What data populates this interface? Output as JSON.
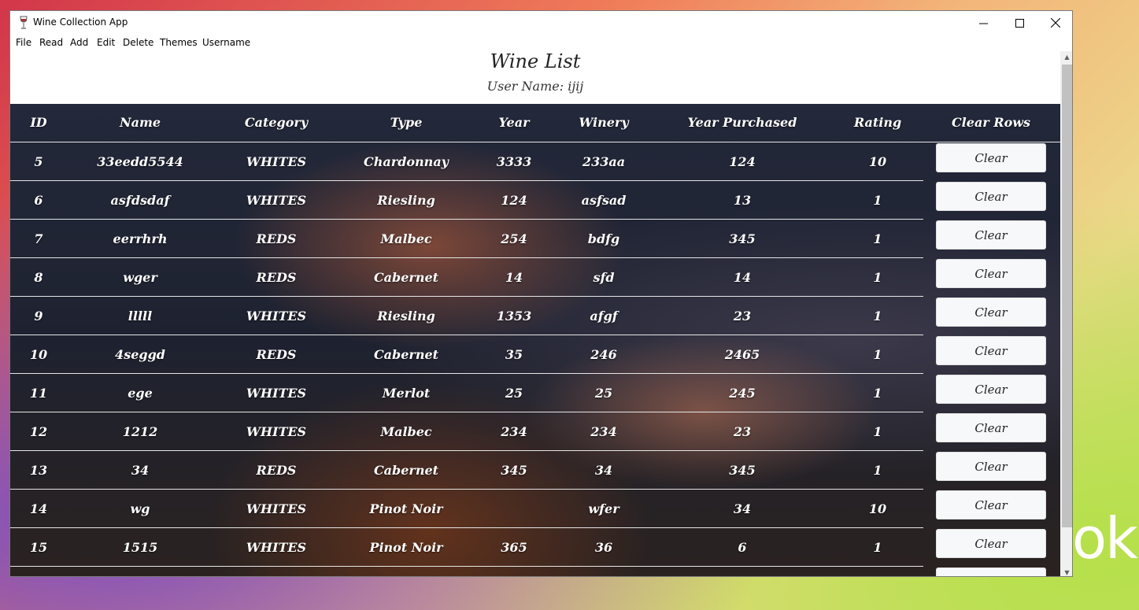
{
  "window": {
    "title": "Wine Collection App",
    "controls": {
      "minimize": "—",
      "maximize": "☐",
      "close": "✕"
    }
  },
  "menu": [
    "File",
    "Read",
    "Add",
    "Edit",
    "Delete",
    "Themes",
    "Username"
  ],
  "page": {
    "title": "Wine List",
    "user_line": "User Name: ijij"
  },
  "table": {
    "columns": [
      "ID",
      "Name",
      "Category",
      "Type",
      "Year",
      "Winery",
      "Year Purchased",
      "Rating",
      "Clear Rows"
    ],
    "button_label": "Clear",
    "rows": [
      [
        "5",
        "33eedd5544",
        "WHITES",
        "Chardonnay",
        "3333",
        "233aa",
        "124",
        "10"
      ],
      [
        "6",
        "asfdsdaf",
        "WHITES",
        "Riesling",
        "124",
        "asfsad",
        "13",
        "1"
      ],
      [
        "7",
        "eerrhrh",
        "REDS",
        "Malbec",
        "254",
        "bdfg",
        "345",
        "1"
      ],
      [
        "8",
        "wger",
        "REDS",
        "Cabernet",
        "14",
        "sfd",
        "14",
        "1"
      ],
      [
        "9",
        "lllll",
        "WHITES",
        "Riesling",
        "1353",
        "afgf",
        "23",
        "1"
      ],
      [
        "10",
        "4seggd",
        "REDS",
        "Cabernet",
        "35",
        "246",
        "2465",
        "1"
      ],
      [
        "11",
        "ege",
        "WHITES",
        "Merlot",
        "25",
        "25",
        "245",
        "1"
      ],
      [
        "12",
        "1212",
        "WHITES",
        "Malbec",
        "234",
        "234",
        "23",
        "1"
      ],
      [
        "13",
        "34",
        "REDS",
        "Cabernet",
        "345",
        "34",
        "345",
        "1"
      ],
      [
        "14",
        "wg",
        "WHITES",
        "Pinot Noir",
        "",
        "wfer",
        "34",
        "10"
      ],
      [
        "15",
        "1515",
        "WHITES",
        "Pinot Noir",
        "365",
        "36",
        "6",
        "1"
      ]
    ]
  },
  "desktop": {
    "logo_text": "ok"
  },
  "icons": {
    "app": "wine-glass-icon",
    "scroll_up": "▲",
    "scroll_down": "▼"
  }
}
